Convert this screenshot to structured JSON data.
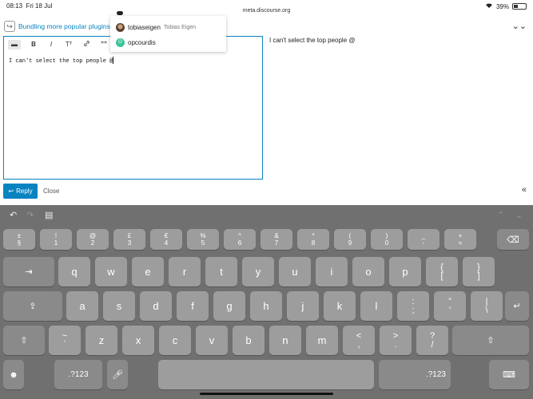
{
  "status_bar": {
    "time": "08:13",
    "date": "Fri 18 Jul",
    "url": "meta.discourse.org",
    "wifi_icon": "wifi-icon",
    "battery": "39%"
  },
  "composer": {
    "topic_title": "Bundling more popular plugins",
    "editor_text": "I can't select the top people @",
    "preview_text": "I can't select the top people @",
    "reply_label": "Reply",
    "close_label": "Close",
    "toolbar": {
      "bold": "B",
      "italic": "I",
      "heading": "Tᵀ",
      "link": "🔗",
      "quote": "””",
      "toggle": "▬"
    }
  },
  "mention_popup": {
    "items": [
      {
        "username": "tobiaseigen",
        "full_name": "Tobias Eigen",
        "avatar": "photo"
      },
      {
        "username": "opcourdis",
        "full_name": "",
        "avatar": "O"
      }
    ]
  },
  "keyboard": {
    "number_row": [
      {
        "top": "±",
        "bottom": "§"
      },
      {
        "top": "!",
        "bottom": "1"
      },
      {
        "top": "@",
        "bottom": "2"
      },
      {
        "top": "£",
        "bottom": "3"
      },
      {
        "top": "€",
        "bottom": "4"
      },
      {
        "top": "%",
        "bottom": "5"
      },
      {
        "top": "^",
        "bottom": "6"
      },
      {
        "top": "&",
        "bottom": "7"
      },
      {
        "top": "*",
        "bottom": "8"
      },
      {
        "top": "(",
        "bottom": "9"
      },
      {
        "top": ")",
        "bottom": "0"
      },
      {
        "top": "_",
        "bottom": "-"
      },
      {
        "top": "+",
        "bottom": "="
      }
    ],
    "row1": [
      "q",
      "w",
      "e",
      "r",
      "t",
      "y",
      "u",
      "i",
      "o",
      "p"
    ],
    "row1_extra": [
      {
        "top": "{",
        "bottom": "["
      },
      {
        "top": "}",
        "bottom": "]"
      }
    ],
    "row2": [
      "a",
      "s",
      "d",
      "f",
      "g",
      "h",
      "j",
      "k",
      "l"
    ],
    "row2_extra": [
      {
        "top": ":",
        "bottom": ";"
      },
      {
        "top": "”",
        "bottom": "'"
      },
      {
        "top": "|",
        "bottom": "\\"
      }
    ],
    "row3_pre": {
      "top": "~",
      "bottom": "`"
    },
    "row3": [
      "z",
      "x",
      "c",
      "v",
      "b",
      "n",
      "m"
    ],
    "row3_extra": [
      {
        "top": "<",
        "bottom": ","
      },
      {
        "top": ">",
        "bottom": "."
      },
      {
        "top": "?",
        "bottom": "/"
      }
    ],
    "numeric_label_left": ".?123",
    "numeric_label_right": ".?123"
  }
}
